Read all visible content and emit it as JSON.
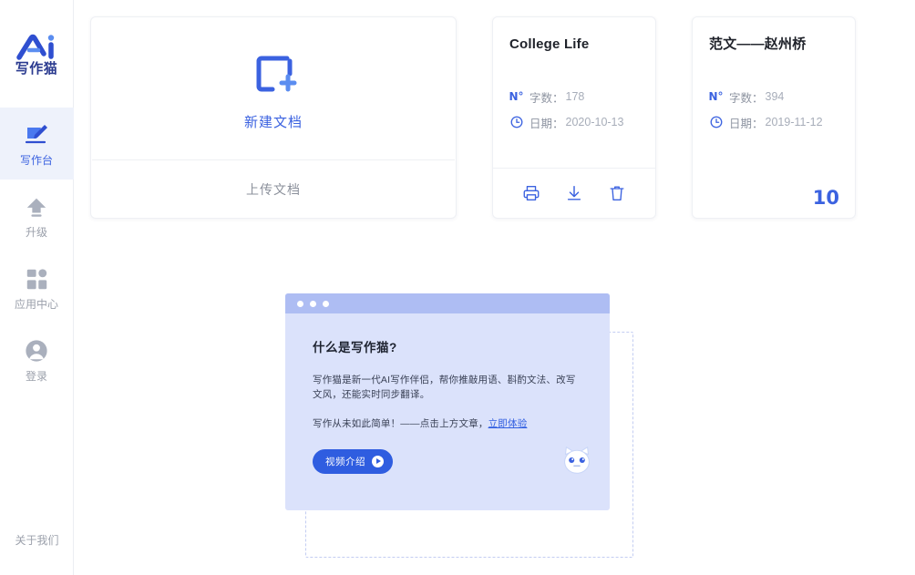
{
  "sidebar": {
    "logo": {
      "icon": "ai-logo-icon",
      "text": "写作猫"
    },
    "items": [
      {
        "label": "写作台",
        "icon": "edit-pencil-icon",
        "active": true
      },
      {
        "label": "升级",
        "icon": "upgrade-arrow-icon",
        "active": false
      },
      {
        "label": "应用中心",
        "icon": "apps-grid-icon",
        "active": false
      },
      {
        "label": "登录",
        "icon": "user-account-icon",
        "active": false
      }
    ],
    "footer": {
      "label": "关于我们"
    }
  },
  "new_card": {
    "icon": "new-document-plus-icon",
    "create_label": "新建文档",
    "upload_label": "上传文档"
  },
  "documents": [
    {
      "title": "College Life",
      "wordcount_icon": "number-sign-icon",
      "wordcount_label": "字数：",
      "wordcount_value": "178",
      "date_icon": "clock-icon",
      "date_label": "日期：",
      "date_value": "2020-10-13",
      "actions": [
        {
          "name": "print-icon",
          "label": "打印"
        },
        {
          "name": "download-icon",
          "label": "下载"
        },
        {
          "name": "trash-icon",
          "label": "删除"
        }
      ],
      "count": ""
    },
    {
      "title": "范文——赵州桥",
      "wordcount_icon": "number-sign-icon",
      "wordcount_label": "字数：",
      "wordcount_value": "394",
      "date_icon": "clock-icon",
      "date_label": "日期：",
      "date_value": "2019-11-12",
      "actions": [],
      "count": "10"
    }
  ],
  "promo": {
    "window_dots": 3,
    "heading": "什么是写作猫?",
    "paragraph": "写作猫是新一代AI写作伴侣，帮你推敲用语、斟酌文法、改写文风，还能实时同步翻译。",
    "cta_text": "写作从未如此简单！——点击上方文章，",
    "cta_link": "立即体验",
    "button_label": "视频介绍",
    "button_icon": "play-icon",
    "mascot_icon": "cat-mascot-icon"
  },
  "colors": {
    "accent": "#3b62e0",
    "promo_bg": "#dbe2fb",
    "promo_titlebar": "#aebdf3",
    "active_nav_bg": "#eef2fb",
    "muted_text": "#9aa0ad"
  }
}
